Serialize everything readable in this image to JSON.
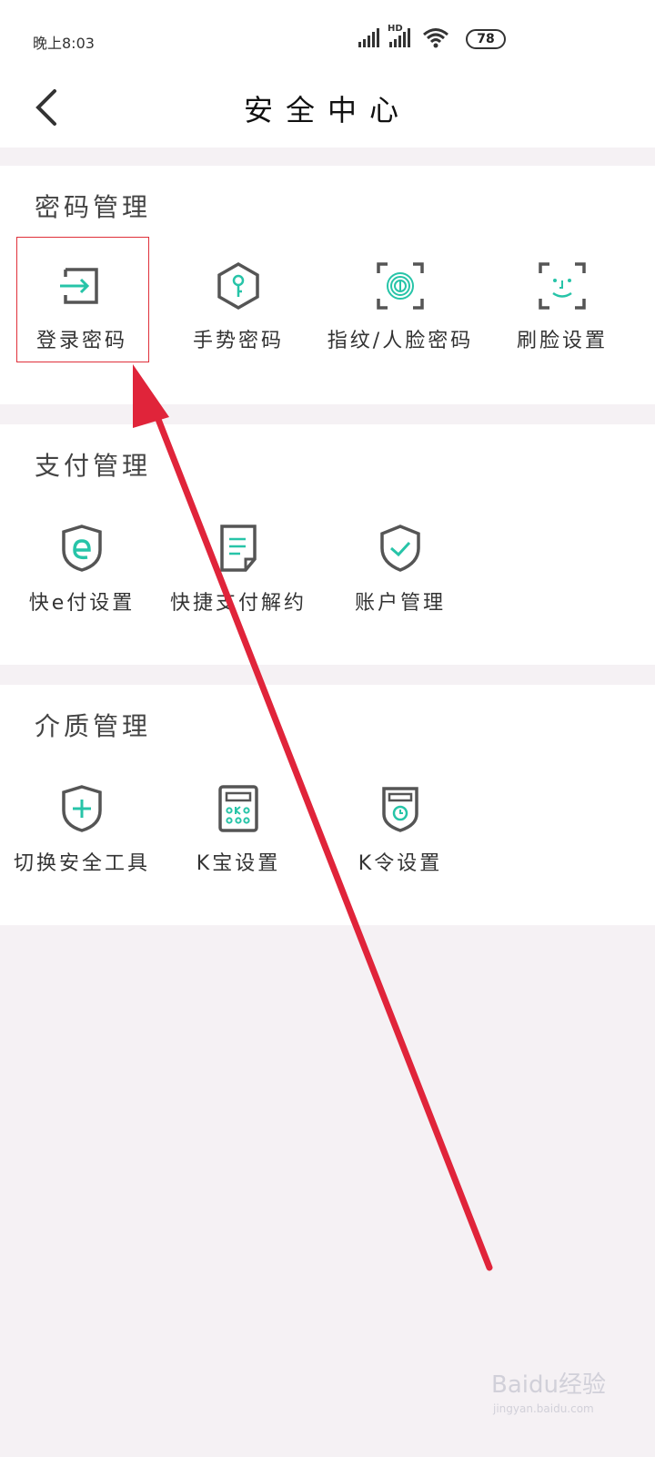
{
  "status": {
    "time": "晚上8:03",
    "network_label": "HD",
    "battery": "78"
  },
  "header": {
    "title": "安全中心"
  },
  "sections": [
    {
      "title": "密码管理",
      "items": [
        {
          "label": "登录密码",
          "icon": "login-icon"
        },
        {
          "label": "手势密码",
          "icon": "gesture-key-icon"
        },
        {
          "label": "指纹/人脸密码",
          "icon": "fingerprint-icon"
        },
        {
          "label": "刷脸设置",
          "icon": "face-scan-icon"
        }
      ]
    },
    {
      "title": "支付管理",
      "items": [
        {
          "label": "快e付设置",
          "icon": "e-pay-shield-icon"
        },
        {
          "label": "快捷支付解约",
          "icon": "document-icon"
        },
        {
          "label": "账户管理",
          "icon": "shield-check-icon"
        }
      ]
    },
    {
      "title": "介质管理",
      "items": [
        {
          "label": "切换安全工具",
          "icon": "shield-plus-icon"
        },
        {
          "label": "K宝设置",
          "icon": "kbao-device-icon"
        },
        {
          "label": "K令设置",
          "icon": "kling-token-icon"
        }
      ]
    }
  ],
  "watermark": {
    "brand": "Baidu经验",
    "url": "jingyan.baidu.com"
  },
  "colors": {
    "accent": "#27c4a8",
    "icon_gray": "#555555",
    "annotation_red": "#e0243a"
  }
}
